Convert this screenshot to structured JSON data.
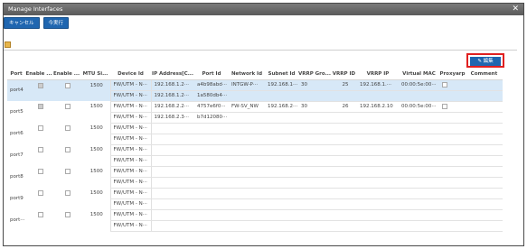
{
  "window": {
    "title": "Manage Interfaces",
    "close": "✕"
  },
  "buttons": {
    "cancel": "キャンセル",
    "apply": "今実行"
  },
  "edit_button": {
    "label": "✎ 編集"
  },
  "columns": [
    "Port",
    "Enable ...",
    "Enable ...",
    "MTU Si...",
    "Device Id",
    "IP Address[C...",
    "Port Id",
    "Network Id",
    "Subnet Id",
    "VRRP Gro...",
    "VRRP ID",
    "VRRP IP",
    "Virtual MAC",
    "Proxyarp",
    "Comment"
  ],
  "rows": [
    {
      "port": "port4",
      "en1": true,
      "en2": false,
      "mtu": "1500",
      "sub": [
        {
          "device": "FW/UTM - N···",
          "ip": "192.168.1.2···",
          "portid": "a4b98abd···",
          "network": "INTGW-P···",
          "subnet": "192.168.1···",
          "vrrpgrp": "30",
          "vrrpid": "25",
          "vrrpip": "192.168.1.···",
          "vmac": "00:00:5e:00···",
          "proxy": false
        },
        {
          "device": "FW/UTM - N···",
          "ip": "192.168.1.2···",
          "portid": "1a580db4···",
          "network": "",
          "subnet": "",
          "vrrpgrp": "",
          "vrrpid": "",
          "vrrpip": "",
          "vmac": "",
          "proxy": null
        }
      ]
    },
    {
      "port": "port5",
      "en1": true,
      "en2": false,
      "mtu": "1500",
      "sub": [
        {
          "device": "FW/UTM - N···",
          "ip": "192.168.2.2···",
          "portid": "4757e6f0···",
          "network": "FW-SV_NW",
          "subnet": "192.168.2···",
          "vrrpgrp": "30",
          "vrrpid": "26",
          "vrrpip": "192.168.2.10",
          "vmac": "00:00:5e:00···",
          "proxy": false
        },
        {
          "device": "FW/UTM - N···",
          "ip": "192.168.2.3···",
          "portid": "b7d12080···",
          "network": "",
          "subnet": "",
          "vrrpgrp": "",
          "vrrpid": "",
          "vrrpip": "",
          "vmac": "",
          "proxy": null
        }
      ]
    },
    {
      "port": "port6",
      "en1": false,
      "en2": false,
      "mtu": "1500",
      "sub": [
        {
          "device": "FW/UTM - N···"
        },
        {
          "device": "FW/UTM - N···"
        }
      ]
    },
    {
      "port": "port7",
      "en1": false,
      "en2": false,
      "mtu": "1500",
      "sub": [
        {
          "device": "FW/UTM - N···"
        },
        {
          "device": "FW/UTM - N···"
        }
      ]
    },
    {
      "port": "port8",
      "en1": false,
      "en2": false,
      "mtu": "1500",
      "sub": [
        {
          "device": "FW/UTM - N···"
        },
        {
          "device": "FW/UTM - N···"
        }
      ]
    },
    {
      "port": "port9",
      "en1": false,
      "en2": false,
      "mtu": "1500",
      "sub": [
        {
          "device": "FW/UTM - N···"
        },
        {
          "device": "FW/UTM - N···"
        }
      ]
    },
    {
      "port": "port···",
      "en1": false,
      "en2": false,
      "mtu": "1500",
      "sub": [
        {
          "device": "FW/UTM - N···"
        },
        {
          "device": "FW/UTM - N···"
        }
      ]
    }
  ],
  "colors": {
    "primary": "#1f66b0",
    "highlight_border": "#e02020",
    "selected_row": "#d7e8f7"
  }
}
